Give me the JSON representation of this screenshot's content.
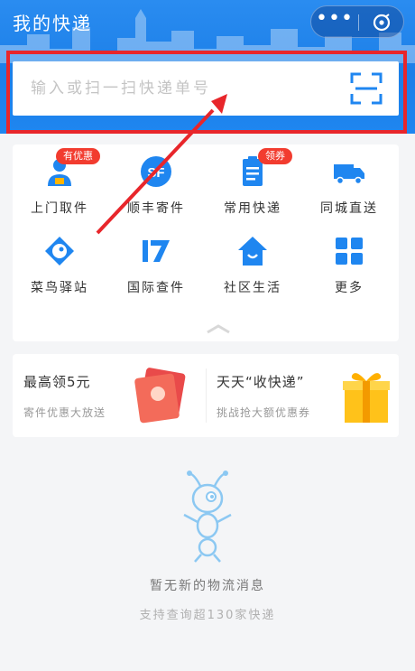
{
  "header": {
    "title": "我的快递",
    "more_glyph": "•••"
  },
  "search": {
    "placeholder": "输入或扫一扫快递单号"
  },
  "services": [
    {
      "label": "上门取件",
      "icon": "courier-person-icon",
      "badge": "有优惠"
    },
    {
      "label": "顺丰寄件",
      "icon": "sf-express-icon",
      "badge": ""
    },
    {
      "label": "常用快递",
      "icon": "clipboard-list-icon",
      "badge": "领券"
    },
    {
      "label": "同城直送",
      "icon": "delivery-truck-icon",
      "badge": ""
    },
    {
      "label": "菜鸟驿站",
      "icon": "cainiao-bird-icon",
      "badge": ""
    },
    {
      "label": "国际查件",
      "icon": "seventeen-track-icon",
      "badge": ""
    },
    {
      "label": "社区生活",
      "icon": "community-house-icon",
      "badge": ""
    },
    {
      "label": "更多",
      "icon": "grid-more-icon",
      "badge": ""
    }
  ],
  "promos": [
    {
      "title": "最高领5元",
      "subtitle": "寄件优惠大放送",
      "icon": "red-envelope-icon"
    },
    {
      "title": "天天“收快递”",
      "subtitle": "挑战抢大额优惠券",
      "icon": "gift-box-icon"
    }
  ],
  "empty_state": {
    "message": "暂无新的物流消息",
    "hint": "支持查询超130家快递"
  },
  "colors": {
    "brand_blue": "#1f86f0",
    "highlight_red": "#e8262b",
    "badge_red": "#f23c2f"
  }
}
